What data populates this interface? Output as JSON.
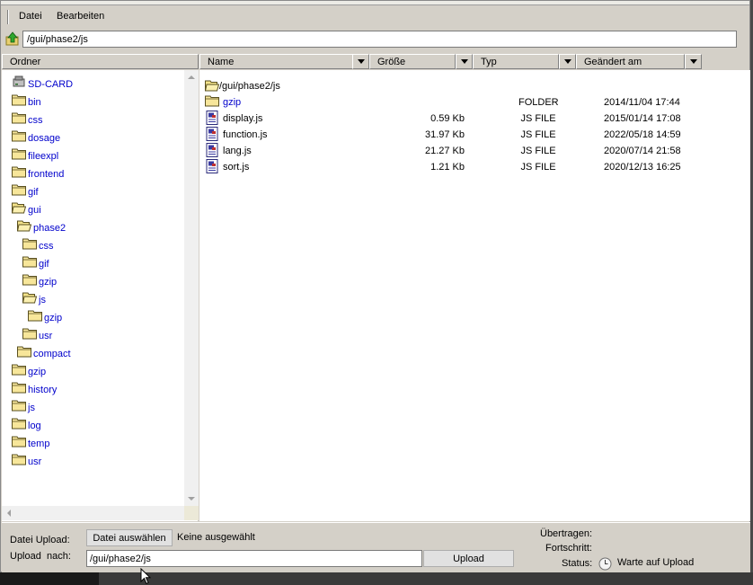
{
  "menu": {
    "items": [
      "Datei",
      "Bearbeiten"
    ]
  },
  "address": {
    "path": "/gui/phase2/js"
  },
  "columns": {
    "folder_header": "Ordner",
    "name": "Name",
    "size": "Größe",
    "type": "Typ",
    "modified": "Geändert am"
  },
  "tree": [
    {
      "label": "SD-CARD",
      "icon": "sd-card-icon",
      "level": 0
    },
    {
      "label": "bin",
      "icon": "folder-icon",
      "level": 0
    },
    {
      "label": "css",
      "icon": "folder-icon",
      "level": 0
    },
    {
      "label": "dosage",
      "icon": "folder-icon",
      "level": 0
    },
    {
      "label": "fileexpl",
      "icon": "folder-icon",
      "level": 0
    },
    {
      "label": "frontend",
      "icon": "folder-icon",
      "level": 0
    },
    {
      "label": "gif",
      "icon": "folder-icon",
      "level": 0
    },
    {
      "label": "gui",
      "icon": "folder-open-icon",
      "level": 0
    },
    {
      "label": "phase2",
      "icon": "folder-open-icon",
      "level": 1
    },
    {
      "label": "css",
      "icon": "folder-icon",
      "level": 2
    },
    {
      "label": "gif",
      "icon": "folder-icon",
      "level": 2
    },
    {
      "label": "gzip",
      "icon": "folder-icon",
      "level": 2
    },
    {
      "label": "js",
      "icon": "folder-open-icon",
      "level": 2
    },
    {
      "label": "gzip",
      "icon": "folder-icon",
      "level": 3
    },
    {
      "label": "usr",
      "icon": "folder-icon",
      "level": 2
    },
    {
      "label": "compact",
      "icon": "folder-icon",
      "level": 1
    },
    {
      "label": "gzip",
      "icon": "folder-icon",
      "level": 0
    },
    {
      "label": "history",
      "icon": "folder-icon",
      "level": 0
    },
    {
      "label": "js",
      "icon": "folder-icon",
      "level": 0
    },
    {
      "label": "log",
      "icon": "folder-icon",
      "level": 0
    },
    {
      "label": "temp",
      "icon": "folder-icon",
      "level": 0
    },
    {
      "label": "usr",
      "icon": "folder-icon",
      "level": 0
    }
  ],
  "files": {
    "current_path": "/gui/phase2/js",
    "rows": [
      {
        "name": "gzip",
        "size": "",
        "type": "FOLDER",
        "date": "2014/11/04 17:44",
        "icon": "folder-icon",
        "is_folder": true
      },
      {
        "name": "display.js",
        "size": "0.59 Kb",
        "type": "JS FILE",
        "date": "2015/01/14 17:08",
        "icon": "js-file-icon",
        "is_folder": false
      },
      {
        "name": "function.js",
        "size": "31.97 Kb",
        "type": "JS FILE",
        "date": "2022/05/18 14:59",
        "icon": "js-file-icon",
        "is_folder": false
      },
      {
        "name": "lang.js",
        "size": "21.27 Kb",
        "type": "JS FILE",
        "date": "2020/07/14 21:58",
        "icon": "js-file-icon",
        "is_folder": false
      },
      {
        "name": "sort.js",
        "size": "1.21 Kb",
        "type": "JS FILE",
        "date": "2020/12/13 16:25",
        "icon": "js-file-icon",
        "is_folder": false
      }
    ]
  },
  "upload": {
    "file_label": "Datei Upload:",
    "choose_button": "Datei auswählen",
    "no_file": "Keine ausgewählt",
    "target_label": "Upload  nach:",
    "target_path": "/gui/phase2/js",
    "upload_button": "Upload",
    "transferred_label": "Übertragen:",
    "progress_label": "Fortschritt:",
    "status_label": "Status:",
    "status_text": "Warte auf Upload"
  },
  "colors": {
    "link": "#0000cc",
    "chrome": "#d4d0c8",
    "folder": "#f4e38a"
  }
}
